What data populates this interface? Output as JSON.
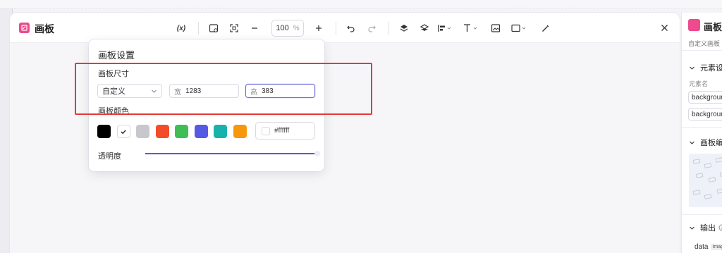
{
  "app": {
    "title": "画板"
  },
  "toolbar": {
    "variable_label": "(x)",
    "zoom_value": "100",
    "zoom_unit": "%"
  },
  "popover": {
    "title": "画板设置",
    "size_section": "画板尺寸",
    "size_preset": "自定义",
    "width_prefix": "宽",
    "width_value": "1283",
    "height_prefix": "高",
    "height_value": "383",
    "color_section": "画板颜色",
    "swatches": [
      "#000000",
      "#ffffff",
      "#c8c8cc",
      "#f24c29",
      "#3fbe55",
      "#5659e3",
      "#18b2ad",
      "#f7980c"
    ],
    "selected_swatch": "#ffffff",
    "hex_value": "#ffffff",
    "opacity_label": "透明度",
    "opacity_value": 1.0
  },
  "right_panel": {
    "title": "画板",
    "subtitle": "自定义画板",
    "element_section": "元素设",
    "element_name_label": "元素名",
    "field1": "backgroun",
    "field2": "backgroun",
    "canvas_section": "画板编",
    "output_section": "输出",
    "data_label": "data",
    "data_tag": "Imag"
  },
  "colors": {
    "accent": "#5a5ad6",
    "brand_pink": "#ee4a8d",
    "highlight_red": "#e53935"
  }
}
